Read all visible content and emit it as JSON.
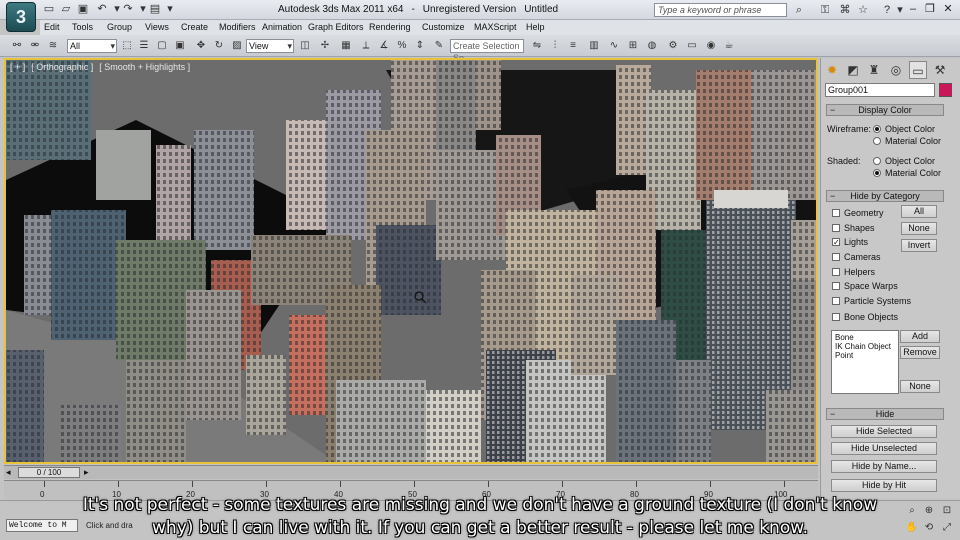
{
  "app": {
    "logo_glyph": "3",
    "title_parts": [
      "Autodesk 3ds Max  2011 x64",
      "-",
      "Unregistered Version",
      "Untitled"
    ],
    "search_placeholder": "Type a keyword or phrase"
  },
  "menu": [
    "Edit",
    "Tools",
    "Group",
    "Views",
    "Create",
    "Modifiers",
    "Animation",
    "Graph Editors",
    "Rendering",
    "Customize",
    "MAXScript",
    "Help"
  ],
  "toolbar": {
    "filter_value": "All",
    "refcoord_value": "View",
    "selection_set_placeholder": "Create Selection Se"
  },
  "viewport": {
    "label_parts": [
      "[ + ]",
      "[ Orthographic ]",
      "[ Smooth + Highlights ]"
    ]
  },
  "command_panel": {
    "object_name": "Group001",
    "object_color": "#c8185a",
    "display_color": {
      "title": "Display Color",
      "wireframe_label": "Wireframe:",
      "shaded_label": "Shaded:",
      "object_color": "Object Color",
      "material_color": "Material Color",
      "wireframe_selected": "Object Color",
      "shaded_selected": "Material Color"
    },
    "hide_by_category": {
      "title": "Hide by Category",
      "items": [
        {
          "label": "Geometry",
          "checked": false
        },
        {
          "label": "Shapes",
          "checked": false
        },
        {
          "label": "Lights",
          "checked": true
        },
        {
          "label": "Cameras",
          "checked": false
        },
        {
          "label": "Helpers",
          "checked": false
        },
        {
          "label": "Space Warps",
          "checked": false
        },
        {
          "label": "Particle Systems",
          "checked": false
        },
        {
          "label": "Bone Objects",
          "checked": false
        }
      ],
      "all_btn": "All",
      "none_btn": "None",
      "invert_btn": "Invert",
      "list": [
        "Bone",
        "IK Chain Object",
        "Point"
      ],
      "add_btn": "Add",
      "remove_btn": "Remove",
      "none2_btn": "None"
    },
    "hide": {
      "title": "Hide",
      "hide_selected": "Hide Selected",
      "hide_unselected": "Hide Unselected",
      "hide_by_name": "Hide by Name...",
      "hide_by_hit": "Hide by Hit"
    }
  },
  "timeline": {
    "slider": "0 / 100",
    "ruler": [
      "0",
      "10",
      "20",
      "30",
      "40",
      "50",
      "60",
      "70",
      "80",
      "90",
      "100"
    ]
  },
  "status": {
    "listener_text": "Welcome to M",
    "prompt_text": "Click and dra"
  },
  "subtitle": {
    "line1": "It's not perfect - some textures are missing and we don't have a ground texture (I don't know",
    "line2": "why) but I can live with it. If you can get a better result - please let me know."
  }
}
